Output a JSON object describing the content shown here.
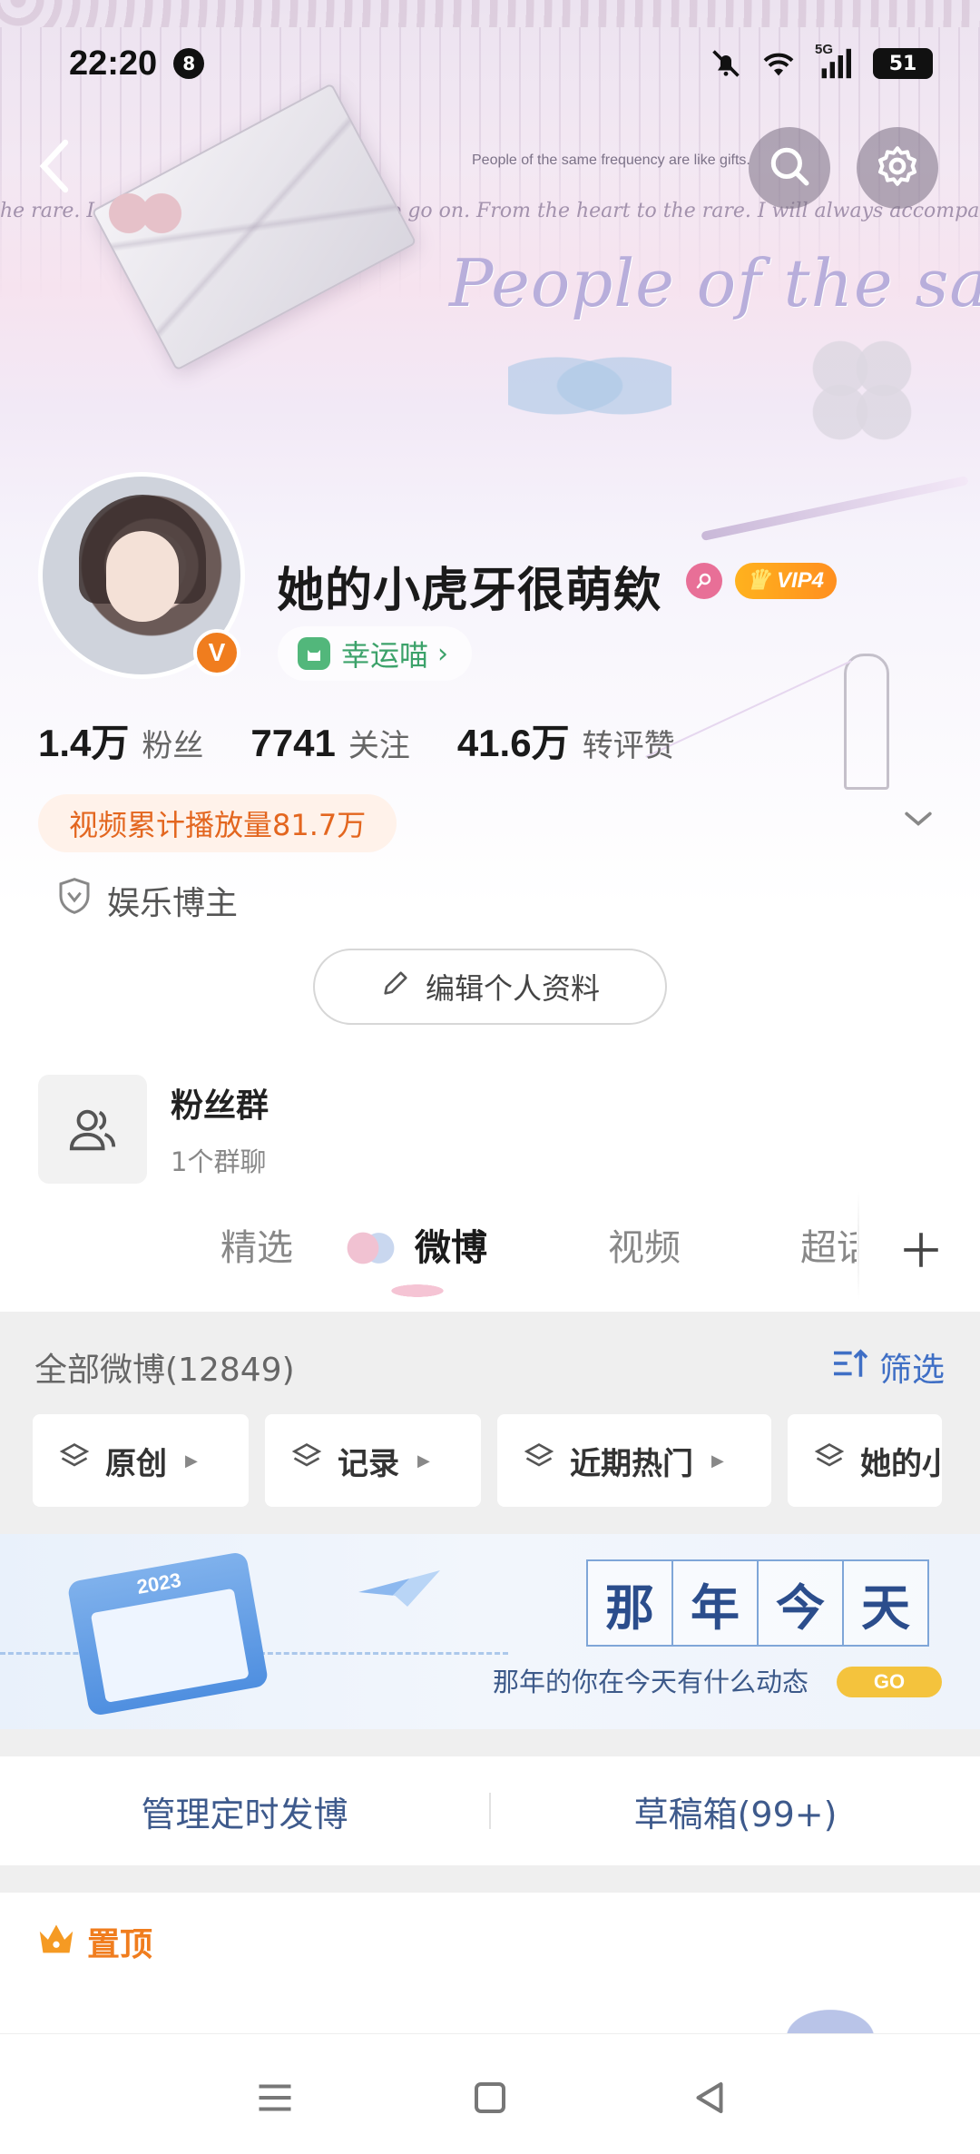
{
  "status_bar": {
    "time": "22:20",
    "notification_count": "8",
    "network_label": "5G",
    "battery_level": "51"
  },
  "banner": {
    "small_text": "People of the same frequency are like gifts.",
    "script_text": "he rare. I will always accompany you to go on.  From the heart to the rare. I will always accompany you to go on.",
    "big_script": "People of the same"
  },
  "profile": {
    "name": "她的小虎牙很萌欸",
    "vip_label": "VIP4",
    "lucky_label": "幸运喵",
    "stats": [
      {
        "value": "1.4万",
        "label": "粉丝"
      },
      {
        "value": "7741",
        "label": "关注"
      },
      {
        "value": "41.6万",
        "label": "转评赞"
      }
    ],
    "play_count": "视频累计播放量81.7万",
    "certification": "娱乐博主",
    "edit_button": "编辑个人资料"
  },
  "fans_group": {
    "title": "粉丝群",
    "subtitle": "1个群聊"
  },
  "tabs": [
    {
      "label": "精选",
      "active": false
    },
    {
      "label": "微博",
      "active": true
    },
    {
      "label": "视频",
      "active": false
    },
    {
      "label": "超话",
      "active": false
    }
  ],
  "feed": {
    "header": "全部微博(12849)",
    "filter_label": "筛选",
    "chips": [
      "原创",
      "记录",
      "近期热门",
      "她的小虎牙"
    ],
    "memory": {
      "year": "2023",
      "title_chars": [
        "那",
        "年",
        "今",
        "天"
      ],
      "subtitle": "那年的你在今天有什么动态",
      "go": "GO"
    },
    "manage": {
      "scheduled": "管理定时发博",
      "drafts": "草稿箱(99+)"
    },
    "pinned_label": "置顶"
  },
  "colors": {
    "accent_orange": "#f07d1e",
    "link_blue": "#3f6fc5",
    "lucky_green": "#3ca26a"
  }
}
